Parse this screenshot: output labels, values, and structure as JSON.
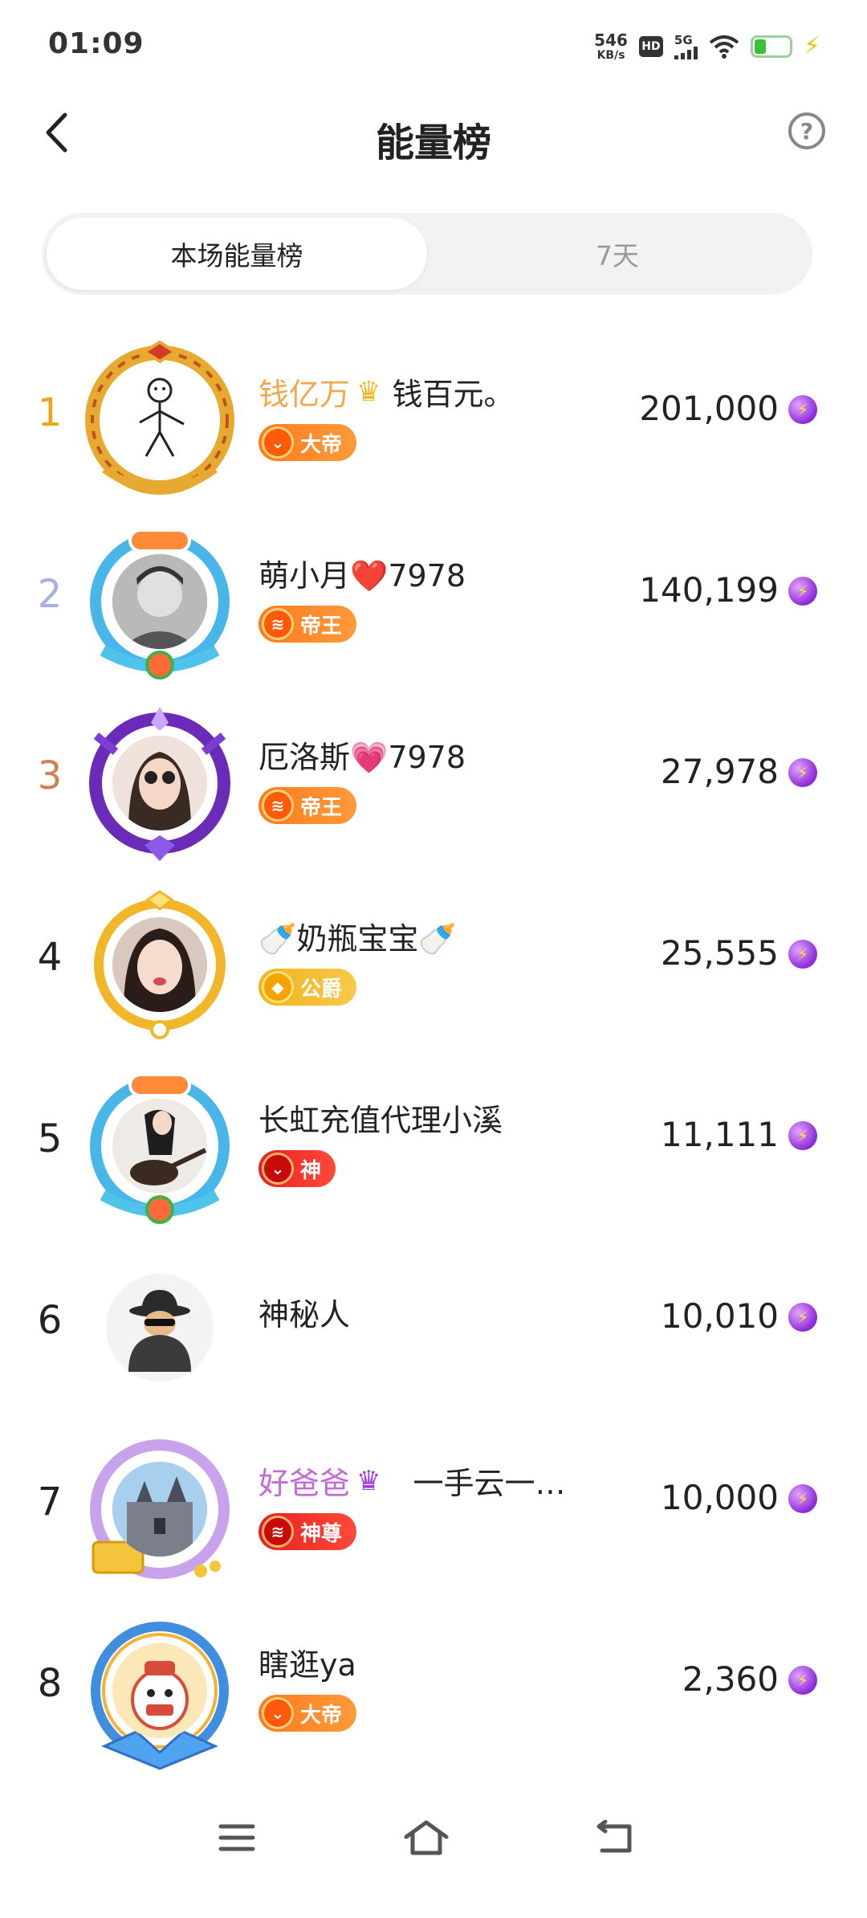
{
  "status_bar": {
    "time": "01:09",
    "net_speed": "546",
    "net_unit": "KB/s",
    "hd": "HD",
    "network": "5G"
  },
  "header": {
    "title": "能量榜",
    "back_icon": "chevron-left-icon",
    "help_icon": "question-circle-icon",
    "help_glyph": "?"
  },
  "tabs": [
    {
      "label": "本场能量榜",
      "active": true
    },
    {
      "label": "7天",
      "active": false
    }
  ],
  "ranking": [
    {
      "rank": "1",
      "prefix": "钱亿万",
      "name": "钱百元。",
      "badge": "大帝",
      "score": "201,000"
    },
    {
      "rank": "2",
      "prefix": "",
      "name": "萌小月❤️7978",
      "badge": "帝王",
      "score": "140,199"
    },
    {
      "rank": "3",
      "prefix": "",
      "name": "厄洛斯💗7978",
      "badge": "帝王",
      "score": "27,978"
    },
    {
      "rank": "4",
      "prefix": "",
      "name": "🍼奶瓶宝宝🍼",
      "badge": "公爵",
      "score": "25,555"
    },
    {
      "rank": "5",
      "prefix": "",
      "name": "长虹充值代理小溪",
      "badge": "神",
      "score": "11,111"
    },
    {
      "rank": "6",
      "prefix": "",
      "name": "神秘人",
      "badge": "",
      "score": "10,010"
    },
    {
      "rank": "7",
      "prefix": "好爸爸",
      "name": "一手云一…",
      "badge": "神尊",
      "score": "10,000"
    },
    {
      "rank": "8",
      "prefix": "",
      "name": "瞎逛ya",
      "badge": "大帝",
      "score": "2,360"
    }
  ],
  "colors": {
    "rank1": "#f0a318",
    "rank2": "#a8aee8",
    "rank3": "#cf8150",
    "energy": "#8c2ad8",
    "badge_orange": "#ff7a1c",
    "badge_gold": "#f1b21c",
    "badge_red": "#e52020"
  },
  "nav": {
    "menu_icon": "menu-icon",
    "home_icon": "home-icon",
    "back_icon": "back-icon"
  }
}
